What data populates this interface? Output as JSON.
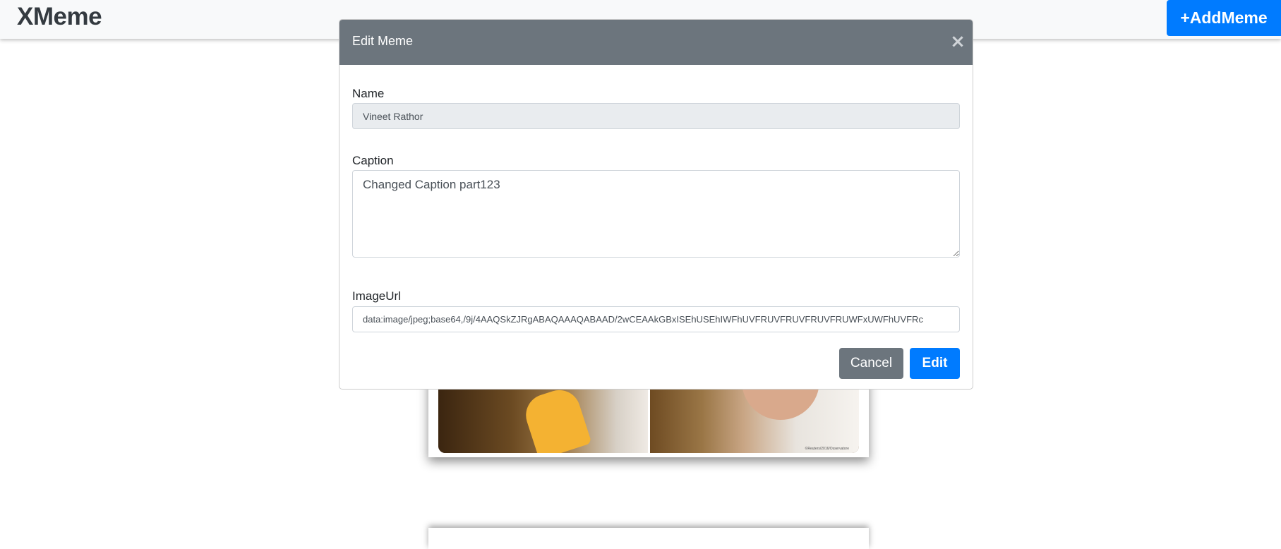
{
  "navbar": {
    "brand": "XMeme",
    "add_button_label": "+AddMeme"
  },
  "modal": {
    "title": "Edit Meme",
    "close_symbol": "×",
    "fields": {
      "name": {
        "label": "Name",
        "value": "Vineet Rathor"
      },
      "caption": {
        "label": "Caption",
        "value": "Changed Caption part123"
      },
      "image_url": {
        "label": "ImageUrl",
        "value": "data:image/jpeg;base64,/9j/4AAQSkZJRgABAQAAAQABAAD/2wCEAAkGBxISEhUSEhIWFhUVFRUVFRUVFRUVFRUWFxUWFhUVFRc"
      }
    },
    "buttons": {
      "cancel": "Cancel",
      "edit": "Edit"
    }
  },
  "meme_card": {
    "credit": "©Reuters/2016/Osservatore"
  },
  "colors": {
    "primary": "#007bff",
    "secondary": "#6c757d",
    "navbar_bg": "#f8f9fa",
    "brand_text": "#343a40"
  },
  "icons": {
    "close": "close-icon"
  }
}
